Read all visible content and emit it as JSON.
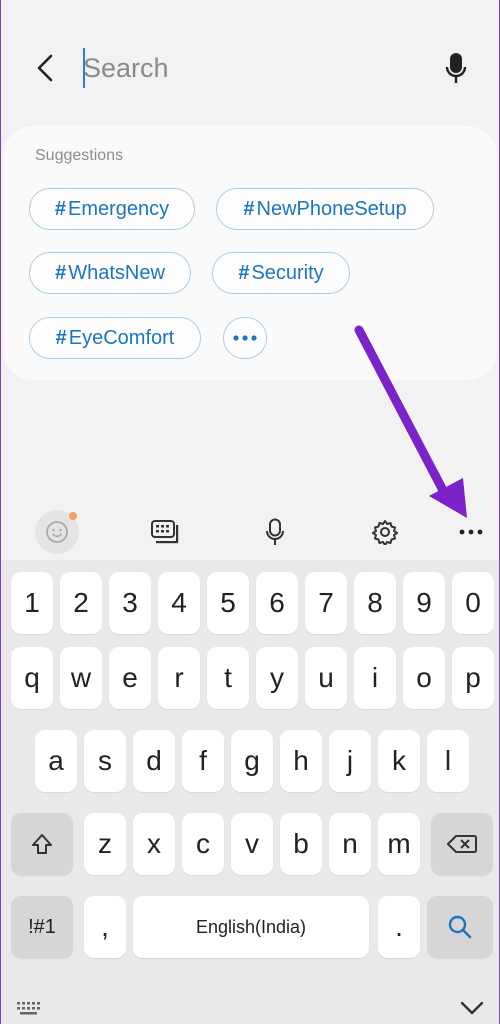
{
  "search": {
    "placeholder": "Search"
  },
  "suggestions": {
    "title": "Suggestions",
    "chips": [
      {
        "hash": "#",
        "label": "Emergency"
      },
      {
        "hash": "#",
        "label": "NewPhoneSetup"
      },
      {
        "hash": "#",
        "label": "WhatsNew"
      },
      {
        "hash": "#",
        "label": "Security"
      },
      {
        "hash": "#",
        "label": "EyeComfort"
      }
    ]
  },
  "toolbar": {
    "items": [
      "emoji-icon",
      "keyboard-icon",
      "mic-icon",
      "gear-icon",
      "more-icon"
    ]
  },
  "keyboard": {
    "numbers": [
      "1",
      "2",
      "3",
      "4",
      "5",
      "6",
      "7",
      "8",
      "9",
      "0"
    ],
    "row1": [
      "q",
      "w",
      "e",
      "r",
      "t",
      "y",
      "u",
      "i",
      "o",
      "p"
    ],
    "row2": [
      "a",
      "s",
      "d",
      "f",
      "g",
      "h",
      "j",
      "k",
      "l"
    ],
    "row3": [
      "z",
      "x",
      "c",
      "v",
      "b",
      "n",
      "m"
    ],
    "symbols_label": "!#1",
    "comma_label": ",",
    "space_label": "English(India)",
    "period_label": "."
  },
  "colors": {
    "accent": "#1d74c4",
    "chip_border": "#a9cfe9",
    "annotation_arrow": "#7b22c8"
  }
}
